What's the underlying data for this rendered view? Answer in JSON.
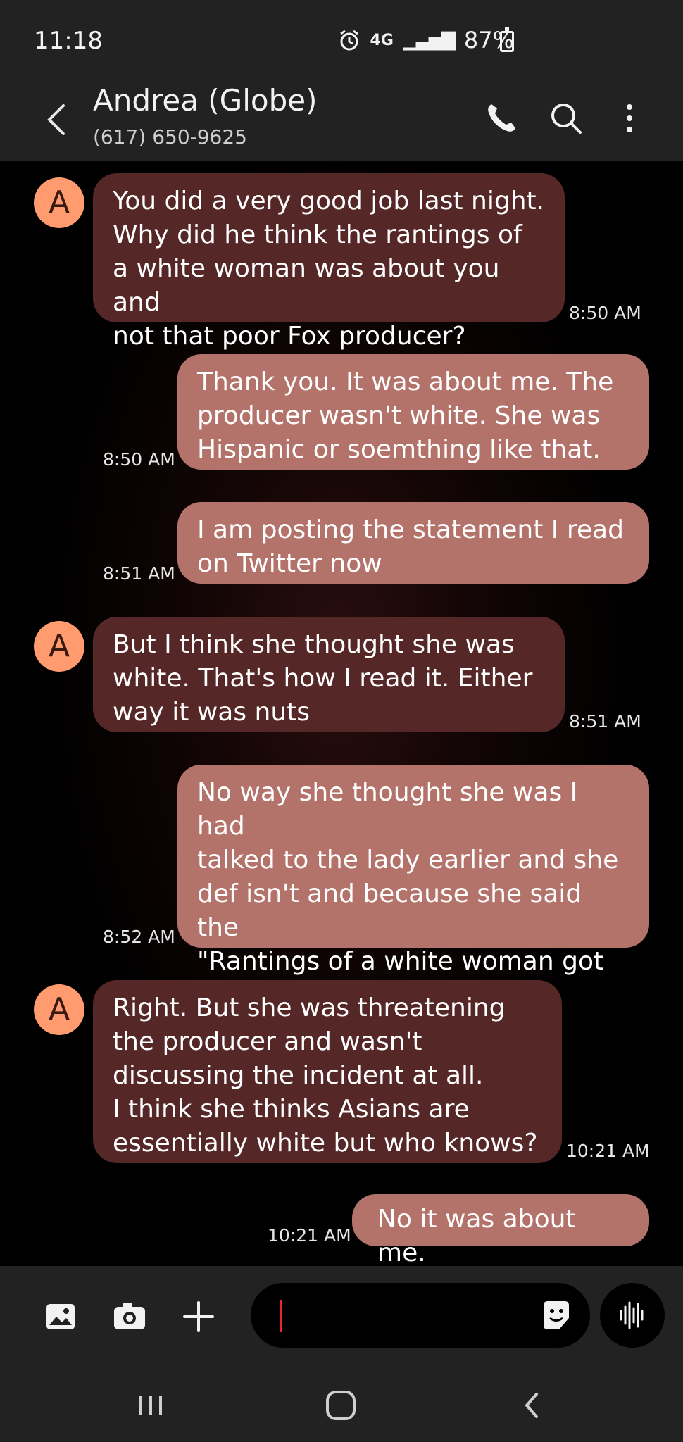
{
  "status_bar": {
    "time": "11:18",
    "network": "4G",
    "battery": "87%"
  },
  "header": {
    "contact_name": "Andrea (Globe)",
    "contact_number": "(617) 650-9625"
  },
  "messages": [
    {
      "direction": "incoming",
      "avatar_letter": "A",
      "text": "You did a very good job last night.\nWhy did he think the rantings  of\na white woman was about you and\nnot that poor Fox producer?",
      "time": "8:50 AM"
    },
    {
      "direction": "outgoing",
      "text": "Thank you. It was about me. The\nproducer wasn't white. She was\nHispanic or soemthing like that.",
      "time": "8:50 AM"
    },
    {
      "direction": "outgoing",
      "text": "I am posting the statement I read\non Twitter now",
      "time": "8:51 AM"
    },
    {
      "direction": "incoming",
      "avatar_letter": "A",
      "text": "But I think she thought she was\nwhite. That's how I read it. Either\nway it was nuts",
      "time": "8:51 AM"
    },
    {
      "direction": "outgoing",
      "text": "No way she thought she was I had\ntalked to the lady earlier and she\ndef isn't and because she said the\n\"Rantings of a white woman got\nyou here\"",
      "time": "8:52 AM"
    },
    {
      "direction": "incoming",
      "avatar_letter": "A",
      "text": "Right. But she was threatening\nthe producer and wasn't\ndiscussing the incident at all.\nI think she thinks Asians are\nessentially white but who knows?",
      "time": "10:21 AM"
    },
    {
      "direction": "outgoing",
      "text": "No it was about me.",
      "time": "10:21 AM"
    }
  ],
  "composer": {
    "input_value": "",
    "placeholder": ""
  },
  "icons": [
    "back-icon",
    "phone-icon",
    "search-icon",
    "more-icon",
    "gallery-icon",
    "camera-icon",
    "plus-icon",
    "sticker-icon",
    "voice-icon",
    "recents-icon",
    "home-icon",
    "nav-back-icon"
  ],
  "colors": {
    "incoming_bubble": "#552727",
    "outgoing_bubble": "#b3736a",
    "avatar": "#ff9b6e",
    "cursor": "#e8262c"
  }
}
